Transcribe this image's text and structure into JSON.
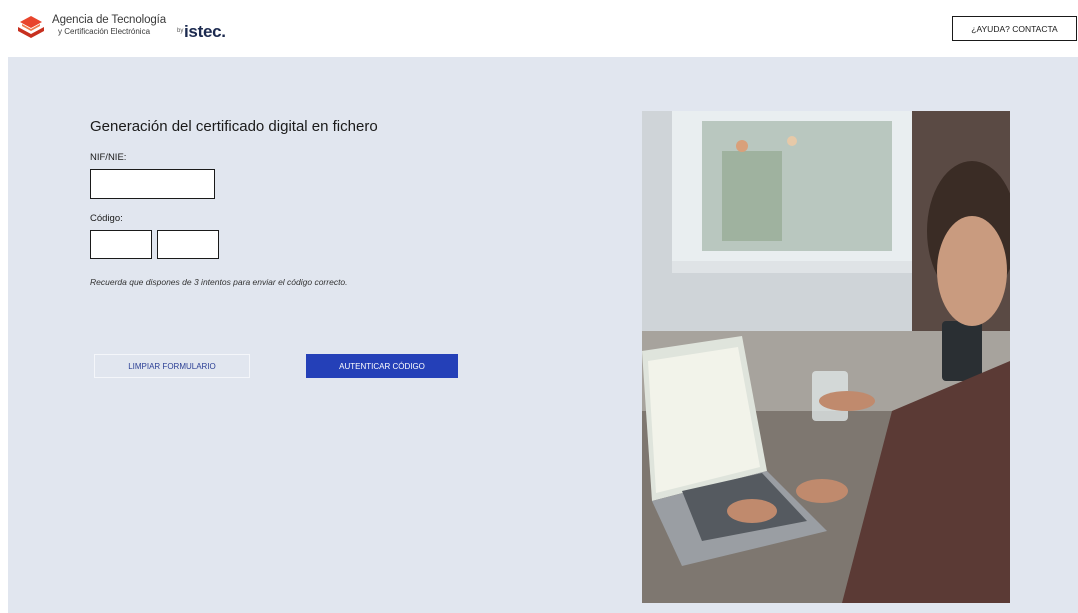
{
  "header": {
    "logo_title": "Agencia de Tecnología",
    "logo_subtitle": "y Certificación Electrónica",
    "logo_by": "by",
    "logo_brand": "istec.",
    "help_label": "¿AYUDA? CONTACTA"
  },
  "form": {
    "title": "Generación del certificado digital en fichero",
    "nif_label": "NIF/NIE:",
    "nif_value": "",
    "code_label": "Código:",
    "code_part1_value": "",
    "code_part2_value": "",
    "hint": "Recuerda que dispones de 3 intentos para enviar el código correcto.",
    "clear_label": "LIMPIAR FORMULARIO",
    "auth_label": "AUTENTICAR CÓDIGO"
  },
  "colors": {
    "background": "#e1e6ef",
    "primary_button": "#2440b8",
    "logo_orange": "#e8452c"
  },
  "icons": {
    "logo": "accv-logo-icon"
  }
}
